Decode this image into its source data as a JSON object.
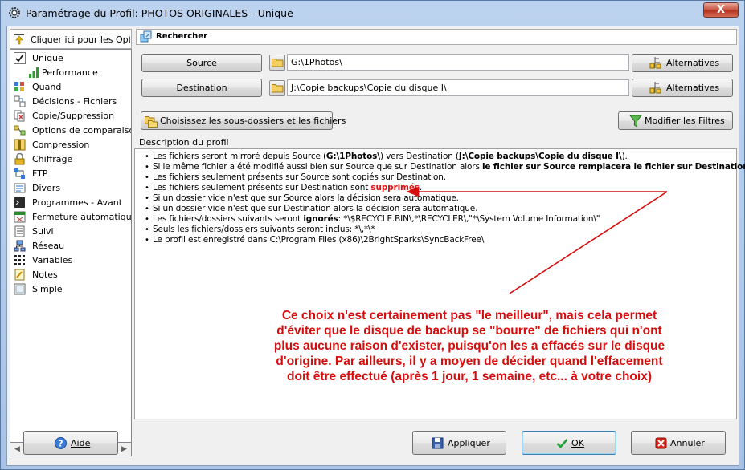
{
  "window": {
    "title": "Paramétrage du Profil: PHOTOS ORIGINALES - Unique",
    "close_label": "X"
  },
  "sidebar": {
    "header_label": "Cliquer ici pour les Options",
    "items": [
      {
        "label": "Unique",
        "icon": "check-icon"
      },
      {
        "label": "Performance",
        "icon": "bar-chart-icon"
      },
      {
        "label": "Quand",
        "icon": "schedule-icon"
      },
      {
        "label": "Décisions - Fichiers",
        "icon": "decision-icon"
      },
      {
        "label": "Copie/Suppression",
        "icon": "copy-delete-icon"
      },
      {
        "label": "Options de comparaison",
        "icon": "compare-icon"
      },
      {
        "label": "Compression",
        "icon": "compression-icon"
      },
      {
        "label": "Chiffrage",
        "icon": "lock-icon"
      },
      {
        "label": "FTP",
        "icon": "ftp-icon"
      },
      {
        "label": "Divers",
        "icon": "misc-icon"
      },
      {
        "label": "Programmes - Avant",
        "icon": "program-icon"
      },
      {
        "label": "Fermeture automatique",
        "icon": "auto-close-icon"
      },
      {
        "label": "Suivi",
        "icon": "log-icon"
      },
      {
        "label": "Réseau",
        "icon": "network-icon"
      },
      {
        "label": "Variables",
        "icon": "variables-icon"
      },
      {
        "label": "Notes",
        "icon": "notes-icon"
      },
      {
        "label": "Simple",
        "icon": "simple-icon"
      }
    ]
  },
  "search": {
    "label": "Rechercher"
  },
  "source": {
    "button_label": "Source",
    "path": "G:\\1Photos\\",
    "alternatives_label": "Alternatives"
  },
  "destination": {
    "button_label": "Destination",
    "path": "J:\\Copie backups\\Copie du disque I\\",
    "alternatives_label": "Alternatives"
  },
  "choose_subfolders_label": "Choisissez les sous-dossiers et les fichiers",
  "modify_filters_label": "Modifier les Filtres",
  "description": {
    "group_label": "Description du profil",
    "lines": [
      {
        "a": "Les fichiers seront mirroré depuis Source (",
        "b": "G:\\1Photos\\",
        "c": ") vers Destination (",
        "d": "J:\\Copie backups\\Copie du disque I\\",
        "e": ")."
      },
      {
        "a": "Si le même fichier a été modifié aussi bien sur Source que sur Destination alors ",
        "b": "le fichier sur Source remplacera le fichier sur Destination."
      },
      {
        "a": "Les fichiers seulement présents sur Source sont copiés sur Destination."
      },
      {
        "a": "Les fichiers seulement présents sur Destination sont ",
        "r": "supprimés",
        "e": "."
      },
      {
        "a": "Si un dossier vide n'est que sur Source alors la décision sera automatique."
      },
      {
        "a": "Si un dossier vide n'est que sur Destination alors la décision sera automatique."
      },
      {
        "a": "Les fichiers/dossiers suivants seront ",
        "b": "ignorés",
        "c": ": *\\$RECYCLE.BIN\\,*\\RECYCLER\\,\"*\\System Volume Information\\\""
      },
      {
        "a": "Seuls les fichiers/dossiers suivants seront inclus: *\\,*\\*"
      },
      {
        "a": "Le profil est enregistré dans C:\\Program Files (x86)\\2BrightSparks\\SyncBackFree\\"
      }
    ]
  },
  "annotation": {
    "lines": [
      "Ce choix n'est certainement pas \"le meilleur\", mais cela permet",
      "d'éviter que le disque de backup se \"bourre\" de fichiers qui n'ont",
      "plus aucune raison d'exister, puisqu'on les a effacés sur le disque",
      "d'origine. Par ailleurs, il y a moyen de décider quand l'effacement",
      "doit être effectué (après 1 jour, 1 semaine, etc... à votre choix)"
    ],
    "color": "#d60d0d"
  },
  "buttons": {
    "help": "Aide",
    "apply": "Appliquer",
    "ok": "OK",
    "cancel": "Annuler"
  }
}
